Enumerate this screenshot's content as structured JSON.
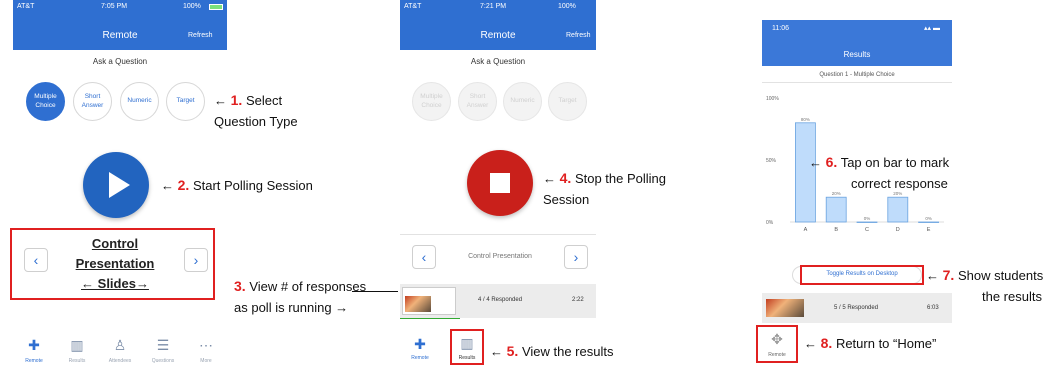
{
  "panel1": {
    "status_carrier": "AT&T",
    "status_time": "7:05 PM",
    "status_battery": "100%",
    "title": "Remote",
    "refresh": "Refresh",
    "ask": "Ask a Question",
    "types": [
      "Multiple Choice",
      "Short Answer",
      "Numeric",
      "Target"
    ],
    "control_lines": [
      "Control",
      "Presentation",
      "← Slides→"
    ],
    "tabs": [
      "Remote",
      "Results",
      "Attendees",
      "Questions",
      "More"
    ]
  },
  "panel2": {
    "status_carrier": "AT&T",
    "status_time": "7:21 PM",
    "status_battery": "100%",
    "title": "Remote",
    "refresh": "Refresh",
    "ask": "Ask a Question",
    "types": [
      "Multiple Choice",
      "Short Answer",
      "Numeric",
      "Target"
    ],
    "control_label": "Control Presentation",
    "responded": "4 / 4 Responded",
    "timer": "2:22",
    "tabs": [
      "Remote",
      "Results"
    ]
  },
  "panel3": {
    "status_time": "11:06",
    "title": "Results",
    "question": "Question 1 - Multiple Choice",
    "toggle": "Toggle Results on Desktop",
    "responded": "5 / 5 Responded",
    "timer": "6:03",
    "home_label": "Remote",
    "chart_data": {
      "type": "bar",
      "categories": [
        "A",
        "B",
        "C",
        "D",
        "E"
      ],
      "values": [
        80,
        20,
        0,
        20,
        0
      ],
      "value_labels": [
        "80%",
        "20%",
        "0%",
        "20%",
        "0%"
      ],
      "y_ticks": [
        "100%",
        "50%",
        "0%"
      ],
      "ylim": [
        0,
        100
      ]
    }
  },
  "annotations": {
    "a1_num": "1.",
    "a1_text": "Select",
    "a1_text2": "Question Type",
    "a2_num": "2.",
    "a2_text": "Start Polling Session",
    "a3_num": "3.",
    "a3_text": "View # of responses",
    "a3_text2": "as poll is running →",
    "a4_num": "4.",
    "a4_text": "Stop the Polling",
    "a4_text2": "Session",
    "a5_num": "5.",
    "a5_text": "View the results",
    "a6_num": "6.",
    "a6_text": "Tap on bar to mark",
    "a6_text2": "correct response",
    "a7_num": "7.",
    "a7_text": "Show students",
    "a7_text2": "the results",
    "a8_num": "8.",
    "a8_text": "Return to “Home”",
    "arrow": "←"
  }
}
